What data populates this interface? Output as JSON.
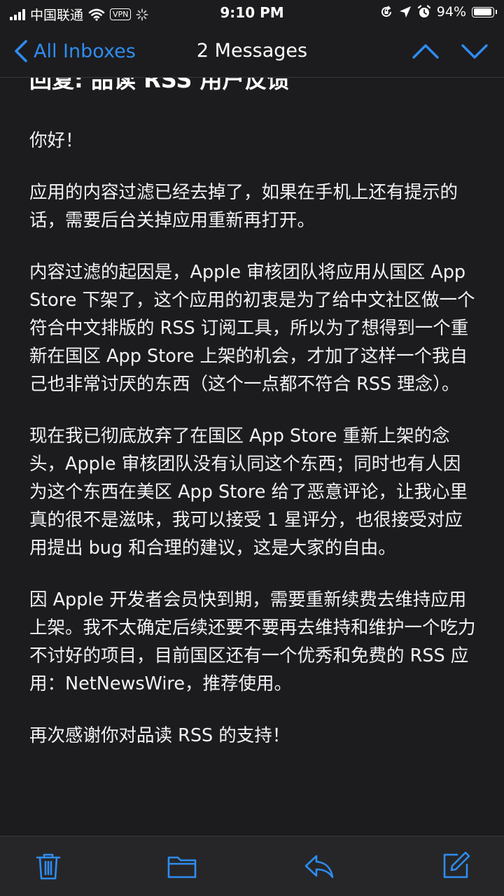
{
  "status_bar": {
    "carrier": "中国联通",
    "vpn": "VPN",
    "time": "9:10 PM",
    "battery": "94%",
    "battery_level": 0.94
  },
  "nav": {
    "back_label": "All Inboxes",
    "title": "2 Messages"
  },
  "email": {
    "subject": "回复: 品读 RSS 用户反馈",
    "paragraphs": [
      "你好！",
      "应用的内容过滤已经去掉了，如果在手机上还有提示的话，需要后台关掉应用重新再打开。",
      "内容过滤的起因是，Apple 审核团队将应用从国区 App Store 下架了，这个应用的初衷是为了给中文社区做一个符合中文排版的 RSS 订阅工具，所以为了想得到一个重新在国区 App Store 上架的机会，才加了这样一个我自己也非常讨厌的东西（这个一点都不符合 RSS 理念）。",
      "现在我已彻底放弃了在国区 App Store 重新上架的念头，Apple 审核团队没有认同这个东西；同时也有人因为这个东西在美区 App Store 给了恶意评论，让我心里真的很不是滋味，我可以接受 1 星评分，也很接受对应用提出 bug 和合理的建议，这是大家的自由。",
      "因 Apple 开发者会员快到期，需要重新续费去维持应用上架。我不太确定后续还要不要再去维持和维护一个吃力不讨好的项目，目前国区还有一个优秀和免费的 RSS 应用：NetNewsWire，推荐使用。",
      "再次感谢你对品读 RSS 的支持！"
    ]
  },
  "toolbar": {
    "icons": [
      "trash-icon",
      "folder-icon",
      "reply-icon",
      "compose-icon"
    ]
  },
  "colors": {
    "accent": "#2f8cf0",
    "background": "#1c1c1e",
    "toolbar_bg": "#262628",
    "text": "#f2f2f7"
  }
}
